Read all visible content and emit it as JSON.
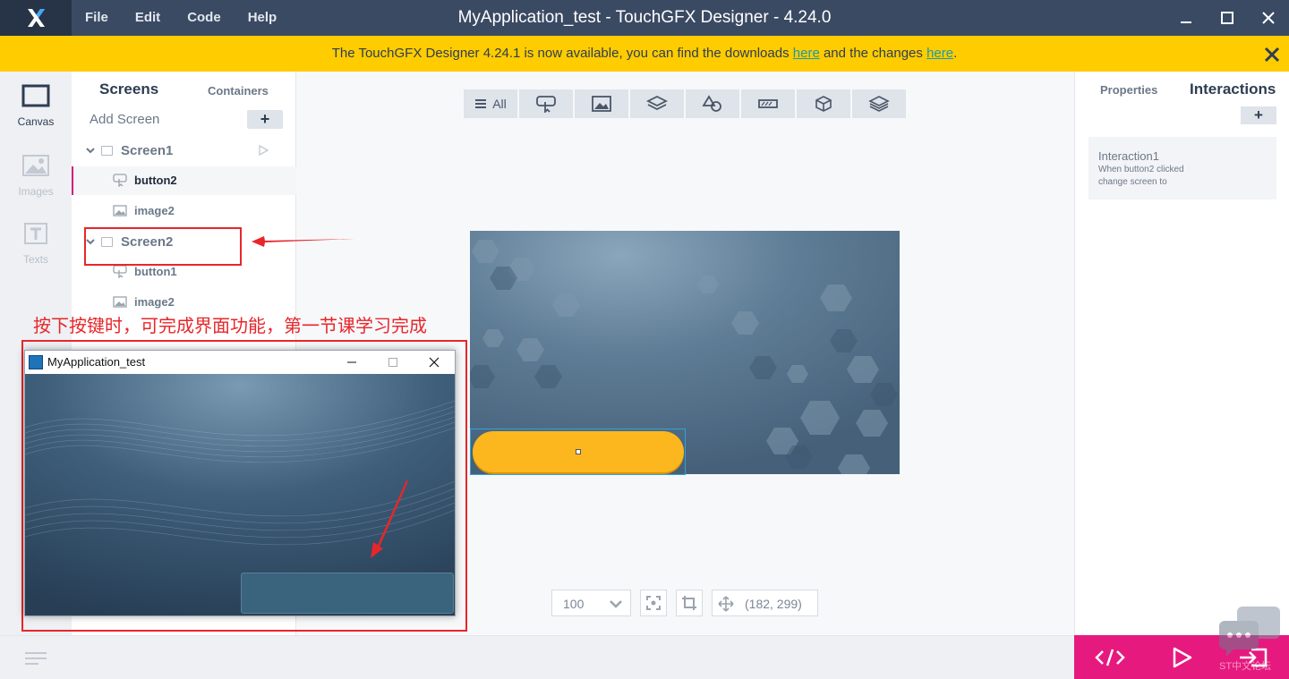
{
  "app": {
    "title": "MyApplication_test - TouchGFX Designer - 4.24.0",
    "menu": [
      "File",
      "Edit",
      "Code",
      "Help"
    ]
  },
  "notification": {
    "text_before": "The TouchGFX Designer 4.24.1 is now available, you can find the downloads ",
    "link1": "here",
    "text_middle": " and the changes ",
    "link2": "here",
    "text_after": "."
  },
  "leftnav": {
    "canvas": "Canvas",
    "images": "Images",
    "texts": "Texts"
  },
  "tree": {
    "tab_screens": "Screens",
    "tab_containers": "Containers",
    "add_screen": "Add Screen",
    "add_button": "+",
    "screen1": {
      "name": "Screen1",
      "children": [
        "button2",
        "image2"
      ]
    },
    "screen2": {
      "name": "Screen2",
      "children": [
        "button1",
        "image2"
      ]
    }
  },
  "toolbar": {
    "all_label": "All"
  },
  "canvas": {
    "zoom": "100",
    "coords": "(182, 299)"
  },
  "rightpanel": {
    "tab_properties": "Properties",
    "tab_interactions": "Interactions",
    "add_button": "+",
    "interaction": {
      "name": "Interaction1",
      "trigger": "When button2 clicked",
      "action": "change screen to"
    }
  },
  "annotation": {
    "text": "按下按键时，可完成界面功能，第一节课学习完成"
  },
  "simulator": {
    "title": "MyApplication_test"
  },
  "watermark": {
    "text": "ST中文论坛"
  },
  "colors": {
    "titlebar": "#3b4a63",
    "notification": "#ffcc00",
    "accent_pink": "#e6197f",
    "button_yellow": "#fbb71d",
    "annotation_red": "#e8262a"
  }
}
